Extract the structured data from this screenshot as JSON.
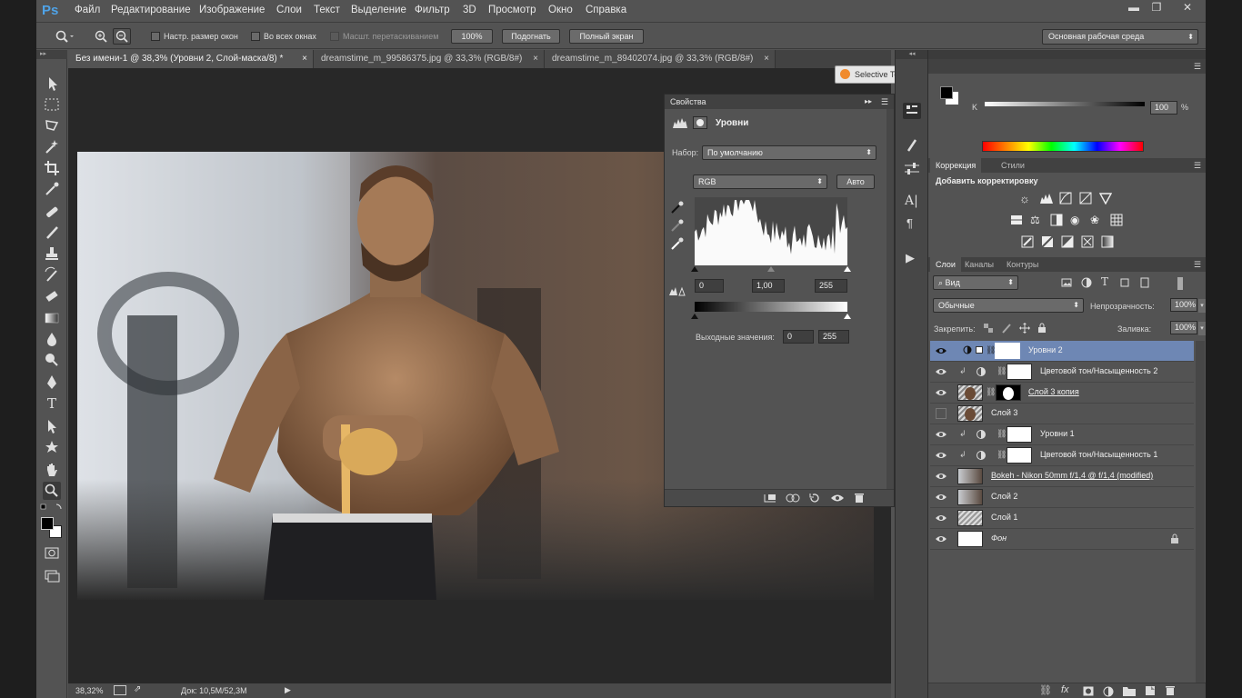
{
  "app": {
    "logo": "Ps",
    "colors": {
      "accent": "#4fa3e8",
      "selected": "#6e87b4"
    }
  },
  "menu": {
    "items": [
      "Файл",
      "Редактирование",
      "Изображение",
      "Слои",
      "Текст",
      "Выделение",
      "Фильтр",
      "3D",
      "Просмотр",
      "Окно",
      "Справка"
    ]
  },
  "window_controls": {
    "minimize": "▬",
    "restore": "❐",
    "close": "✕"
  },
  "options_bar": {
    "resize_windows": "Настр. размер окон",
    "all_windows": "Во всех окнах",
    "scrubby_zoom": "Масшт. перетаскиванием",
    "zoom_100": "100%",
    "fit_screen": "Подогнать",
    "fill_screen": "Полный экран",
    "workspace": "Основная рабочая среда"
  },
  "tabs": [
    {
      "label": "Без имени-1 @ 38,3% (Уровни 2, Слой-маска/8) *",
      "close": "×"
    },
    {
      "label": "dreamstime_m_99586375.jpg @ 33,3% (RGB/8#)",
      "close": "×"
    },
    {
      "label": "dreamstime_m_89402074.jpg @ 33,3% (RGB/8#)",
      "close": "×"
    }
  ],
  "status": {
    "zoom": "38,32%",
    "doc": "Док: 10,5M/52,3M"
  },
  "properties": {
    "title": "Свойства",
    "adjustment": "Уровни",
    "preset_label": "Набор:",
    "preset_value": "По умолчанию",
    "channel": "RGB",
    "auto": "Авто",
    "input_black": "0",
    "input_gamma": "1,00",
    "input_white": "255",
    "output_label": "Выходные значения:",
    "output_black": "0",
    "output_white": "255"
  },
  "selective_tool": {
    "title": "Selective Tool"
  },
  "color_panel": {
    "channel": "K",
    "value": "100",
    "unit": "%"
  },
  "adjustments": {
    "tab_correction": "Коррекция",
    "tab_styles": "Стили",
    "add_label": "Добавить корректировку"
  },
  "layers_panel": {
    "tab_layers": "Слои",
    "tab_channels": "Каналы",
    "tab_paths": "Контуры",
    "filter": "Вид",
    "blend": "Обычные",
    "opacity_label": "Непрозрачность:",
    "opacity": "100%",
    "lock_label": "Закрепить:",
    "fill_label": "Заливка:",
    "fill": "100%",
    "layers": [
      {
        "name": "Уровни 2",
        "selected": true
      },
      {
        "name": "Цветовой тон/Насыщенность 2"
      },
      {
        "name": "Слой 3 копия"
      },
      {
        "name": "Слой 3"
      },
      {
        "name": "Уровни 1"
      },
      {
        "name": "Цветовой тон/Насыщенность 1"
      },
      {
        "name": "Bokeh - Nikon 50mm f/1,4 @ f/1,4 (modified)"
      },
      {
        "name": "Слой 2"
      },
      {
        "name": "Слой 1"
      },
      {
        "name": "Фон"
      }
    ],
    "footer_fx": "fx"
  }
}
